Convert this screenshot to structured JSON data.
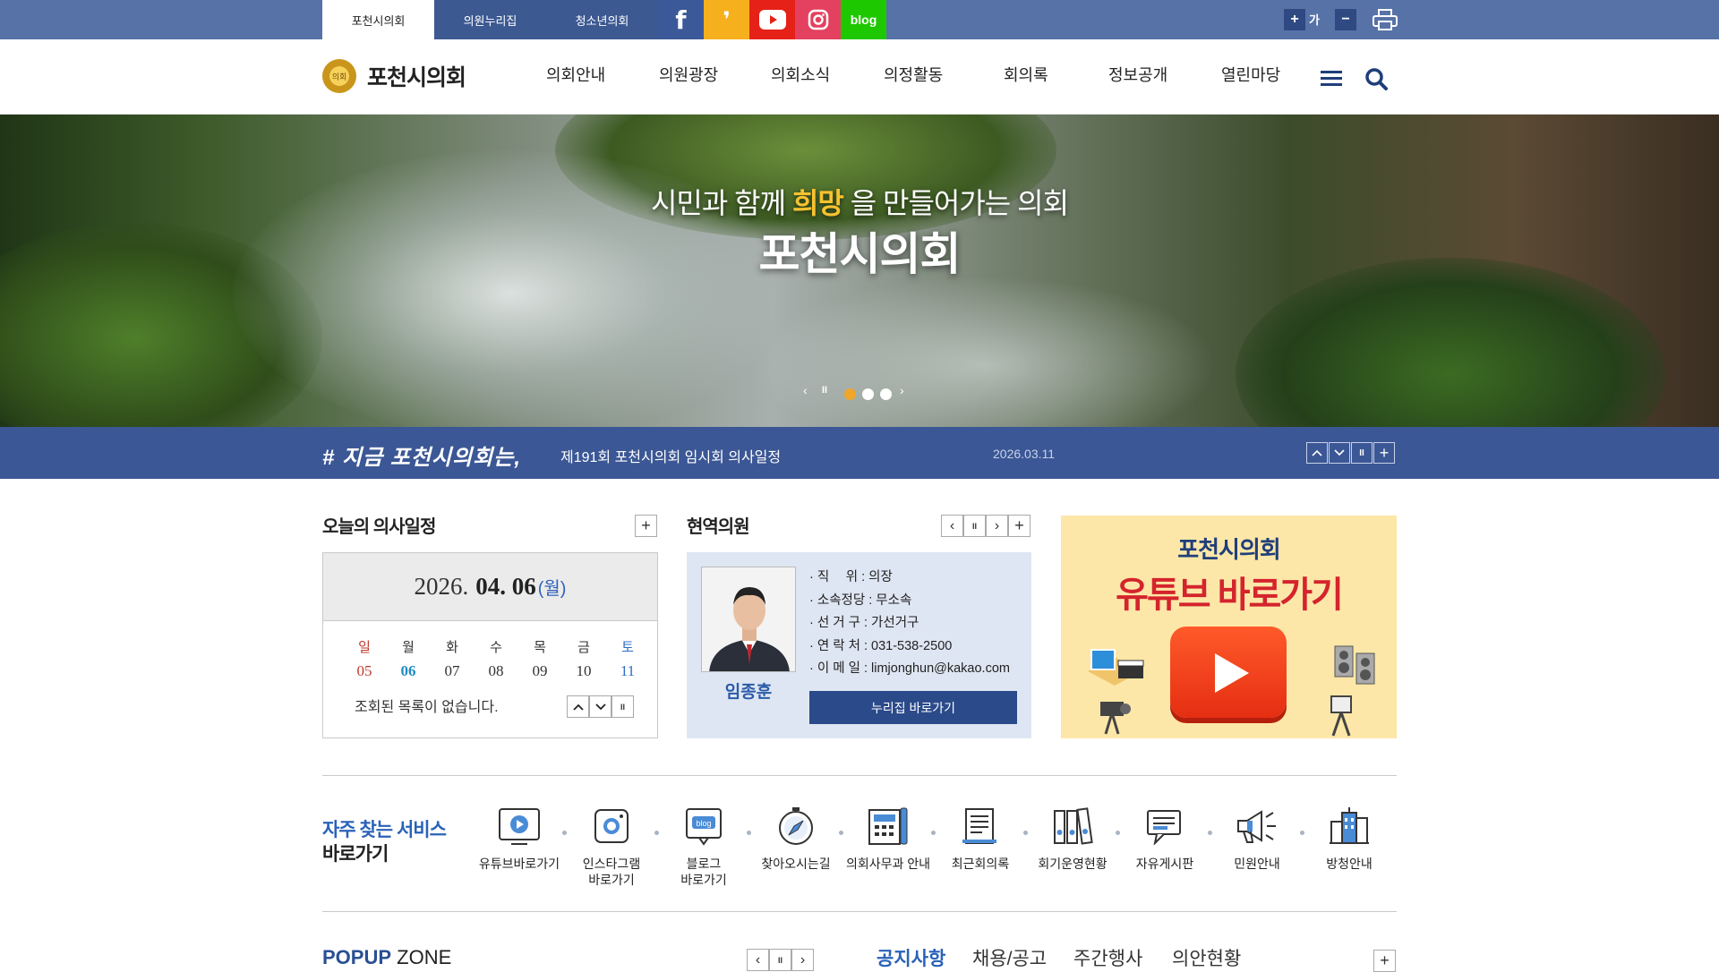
{
  "topbar": {
    "site_tabs": [
      "포천시의회",
      "의원누리집",
      "청소년의회"
    ],
    "sns": [
      {
        "name": "facebook",
        "label": "f",
        "color": "#3b5998"
      },
      {
        "name": "kakaostory",
        "label": "❜",
        "color": "#f6b01d"
      },
      {
        "name": "youtube",
        "label": "▶",
        "color": "#e62117"
      },
      {
        "name": "instagram",
        "label": "◎",
        "color": "#e4405f"
      },
      {
        "name": "blog",
        "label": "blog",
        "color": "#1ec800"
      }
    ],
    "font_plus": "+",
    "font_label": "가",
    "font_minus": "−"
  },
  "header": {
    "logo_text": "포천시의회",
    "logo_mark": "의회",
    "nav": [
      "의회안내",
      "의원광장",
      "의회소식",
      "의정활동",
      "회의록",
      "정보공개",
      "열린마당"
    ]
  },
  "hero": {
    "line1_before": "시민과 함께 ",
    "line1_highlight": "희망",
    "line1_after": " 을 만들어가는 의회",
    "line2": "포천시의회",
    "slide_count": 3,
    "active_slide": 1
  },
  "strip": {
    "title": "# 지금 포천시의회는,",
    "news": "제191회 포천시의회 임시회 의사일정",
    "date": "2026.03.11"
  },
  "schedule": {
    "title": "오늘의 의사일정",
    "date_prefix": "2026.",
    "date_main": "04. 06",
    "weekday": "(월)",
    "days": [
      {
        "d": "일",
        "n": "05"
      },
      {
        "d": "월",
        "n": "06"
      },
      {
        "d": "화",
        "n": "07"
      },
      {
        "d": "수",
        "n": "08"
      },
      {
        "d": "목",
        "n": "09"
      },
      {
        "d": "금",
        "n": "10"
      },
      {
        "d": "토",
        "n": "11"
      }
    ],
    "empty_text": "조회된 목록이 없습니다."
  },
  "member": {
    "title": "현역의원",
    "name": "임종훈",
    "info": [
      "· 직　 위 : 의장",
      "· 소속정당 : 무소속",
      "· 선 거 구 : 가선거구",
      "· 연 락 처 : 031-538-2500",
      "· 이 메 일 : limjonghun@kakao.com"
    ],
    "button": "누리집 바로가기"
  },
  "youtube": {
    "line1": "포천시의회",
    "line2": "유튜브 바로가기"
  },
  "quick": {
    "title1": "자주 찾는 서비스",
    "title2": "바로가기",
    "items": [
      {
        "label": "유튜브바로가기",
        "icon": "youtube-icon"
      },
      {
        "label": "인스타그램\n바로가기",
        "icon": "instagram-icon"
      },
      {
        "label": "블로그\n바로가기",
        "icon": "blog-icon"
      },
      {
        "label": "찾아오시는길",
        "icon": "compass-icon"
      },
      {
        "label": "의회사무과 안내",
        "icon": "directory-icon"
      },
      {
        "label": "최근회의록",
        "icon": "minutes-icon"
      },
      {
        "label": "회기운영현황",
        "icon": "binders-icon"
      },
      {
        "label": "자유게시판",
        "icon": "board-icon"
      },
      {
        "label": "민원안내",
        "icon": "megaphone-icon"
      },
      {
        "label": "방청안내",
        "icon": "building-icon"
      }
    ]
  },
  "popup": {
    "title_bold": "POPUP",
    "title_rest": " ZONE"
  },
  "board_tabs": [
    "공지사항",
    "채용/공고",
    "주간행사",
    "의안현황"
  ],
  "colors": {
    "primary": "#3b5795",
    "accent": "#2a62b9"
  }
}
